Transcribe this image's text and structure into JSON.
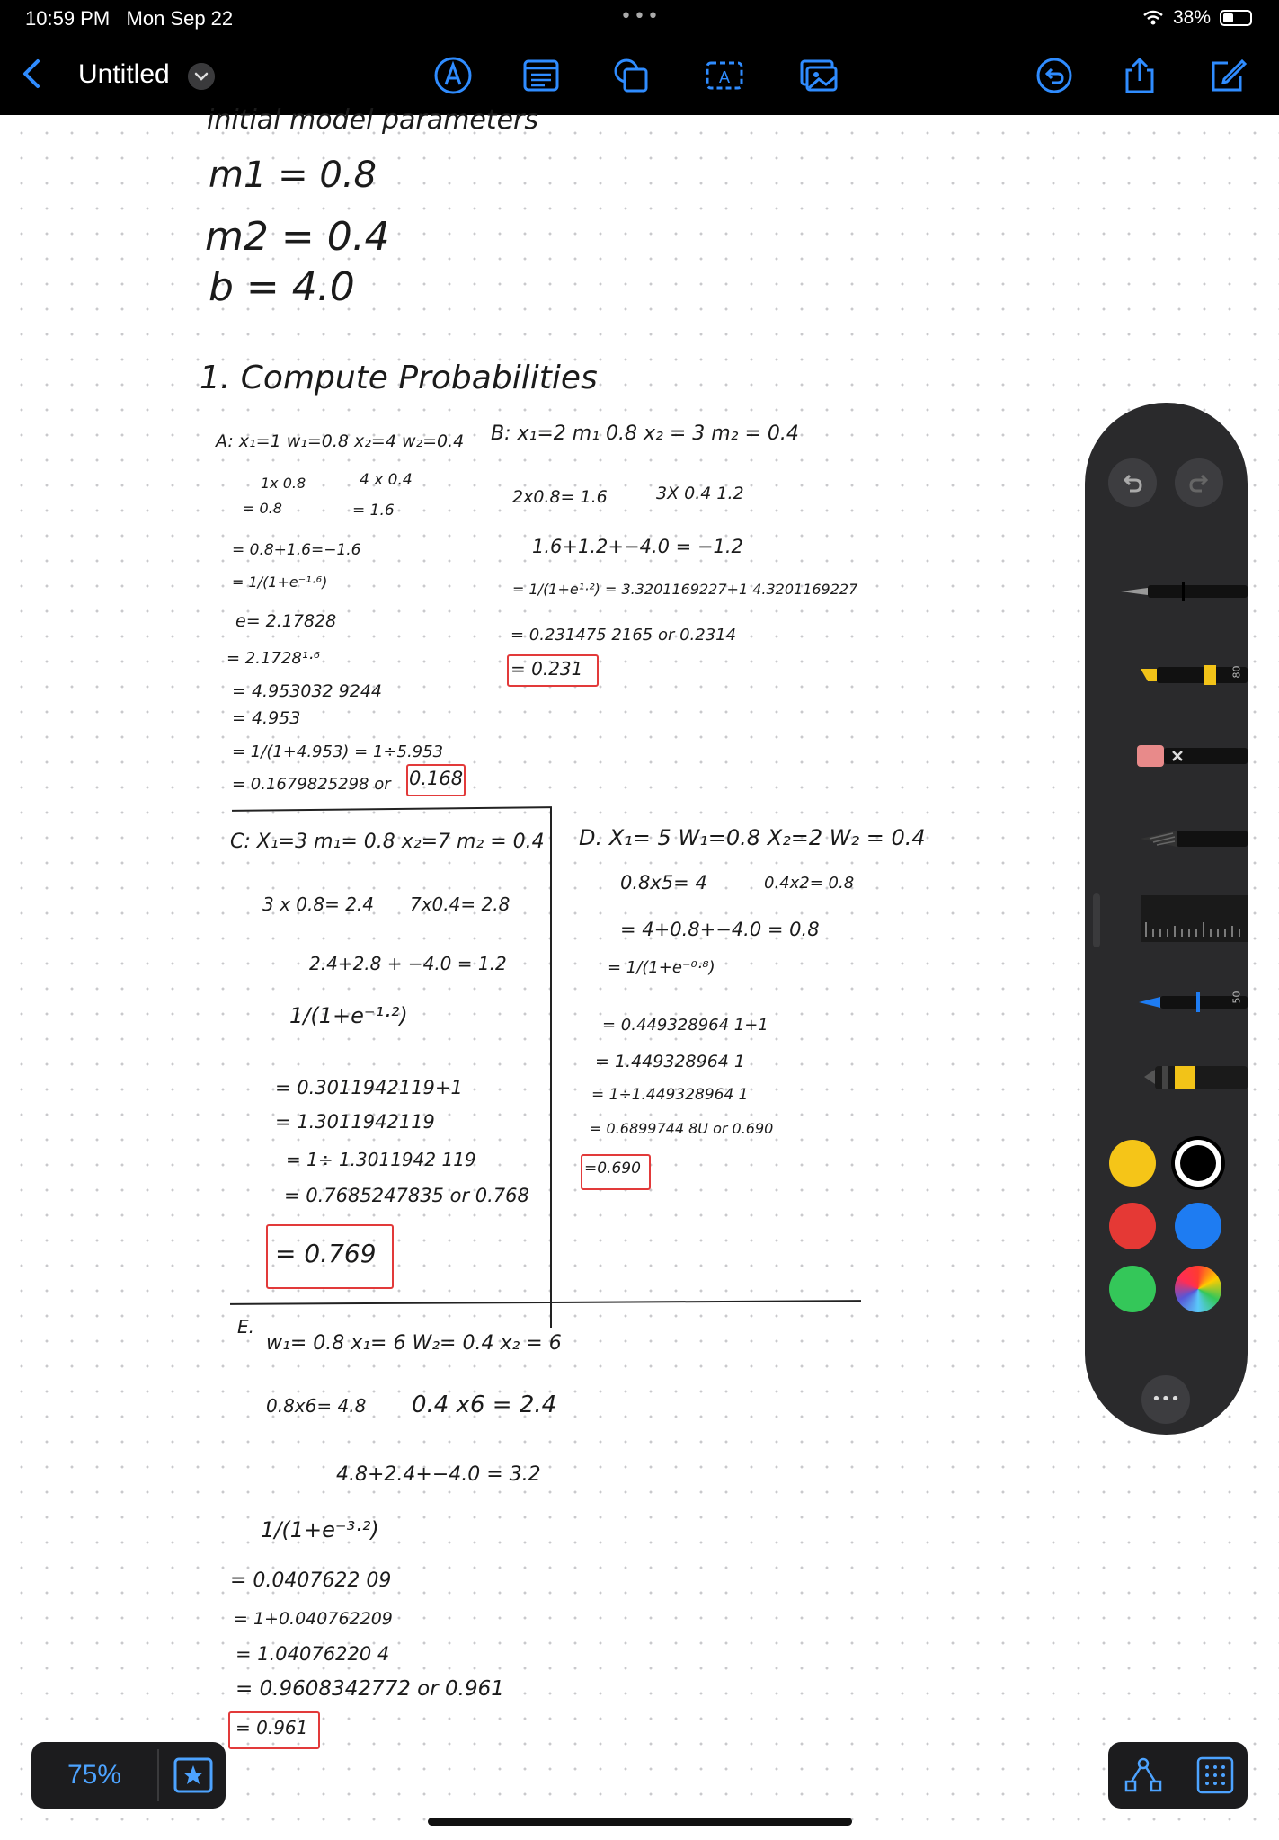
{
  "status_bar": {
    "time": "10:59 PM",
    "date": "Mon Sep 22",
    "battery": "38%"
  },
  "nav": {
    "title": "Untitled",
    "toolbar_icons": [
      "back-icon",
      "markup-pen-icon",
      "text-box-icon",
      "shapes-icon",
      "text-recognition-icon",
      "image-icon",
      "undo-history-icon",
      "share-icon",
      "compose-icon"
    ]
  },
  "zoom": {
    "label": "75%"
  },
  "palette": {
    "pen_size_labels": [
      "80",
      "50"
    ],
    "colors": [
      "#f5c518",
      "#000000",
      "#e53935",
      "#1e7cf2",
      "#34c759",
      "rainbow"
    ],
    "more_label": "•••"
  },
  "notes": {
    "header_cut": "initial model parameters",
    "params": [
      "m1 = 0.8",
      "m2 = 0.4",
      "b = 4.0"
    ],
    "section_title": "1. Compute Probabilities",
    "A": {
      "header": "A: x₁=1 w₁=0.8  x₂=4 w₂=0.4",
      "lines": [
        "1x 0.8",
        "= 0.8",
        "4 x 0.4",
        "= 1.6",
        "= 0.8+1.6=−1.6",
        "= 1/(1+e⁻¹·⁶)",
        "e= 2.17828",
        "= 2.1728¹·⁶",
        "= 4.953032 9244",
        "= 4.953",
        "= 1/(1+4.953) = 1÷5.953",
        "= 0.1679825298 or"
      ],
      "answer": "0.168"
    },
    "B": {
      "header": "B: x₁=2  m₁ 0.8  x₂ = 3  m₂ = 0.4",
      "lines": [
        "2x0.8= 1.6",
        "3X 0.4  1.2",
        "1.6+1.2+−4.0 = −1.2",
        "= 1/(1+e¹·²) = 3.3201169227+1  4.3201169227",
        "= 0.231475 2165 or 0.2314"
      ],
      "answer": "= 0.231"
    },
    "C": {
      "header": "C: X₁=3  m₁= 0.8  x₂=7 m₂ = 0.4",
      "lines": [
        "3 x 0.8= 2.4",
        "7x0.4= 2.8",
        "2.4+2.8 + −4.0 = 1.2",
        "1/(1+e⁻¹·²)",
        "= 0.3011942119+1",
        "= 1.3011942119",
        "= 1÷ 1.3011942 119",
        "= 0.7685247835 or 0.768"
      ],
      "answer": "= 0.769"
    },
    "D": {
      "header": "D. X₁= 5  W₁=0.8  X₂=2  W₂ = 0.4",
      "lines": [
        "0.8x5= 4",
        "0.4x2= 0.8",
        "= 4+0.8+−4.0 = 0.8",
        "= 1/(1+e⁻⁰·⁸)",
        "= 0.449328964 1+1",
        "= 1.449328964 1",
        "= 1÷1.449328964 1",
        "= 0.6899744 8U or 0.690"
      ],
      "answer": "=0.690"
    },
    "E": {
      "label": "E.",
      "header": "w₁= 0.8   x₁= 6   W₂= 0.4   x₂ = 6",
      "lines": [
        "0.8x6= 4.8",
        "0.4 x6 = 2.4",
        "4.8+2.4+−4.0 = 3.2",
        "1/(1+e⁻³·²)",
        "= 0.0407622 09",
        "= 1+0.040762209",
        "= 1.04076220 4",
        "= 0.9608342772 or 0.961"
      ],
      "answer": "= 0.961"
    }
  }
}
